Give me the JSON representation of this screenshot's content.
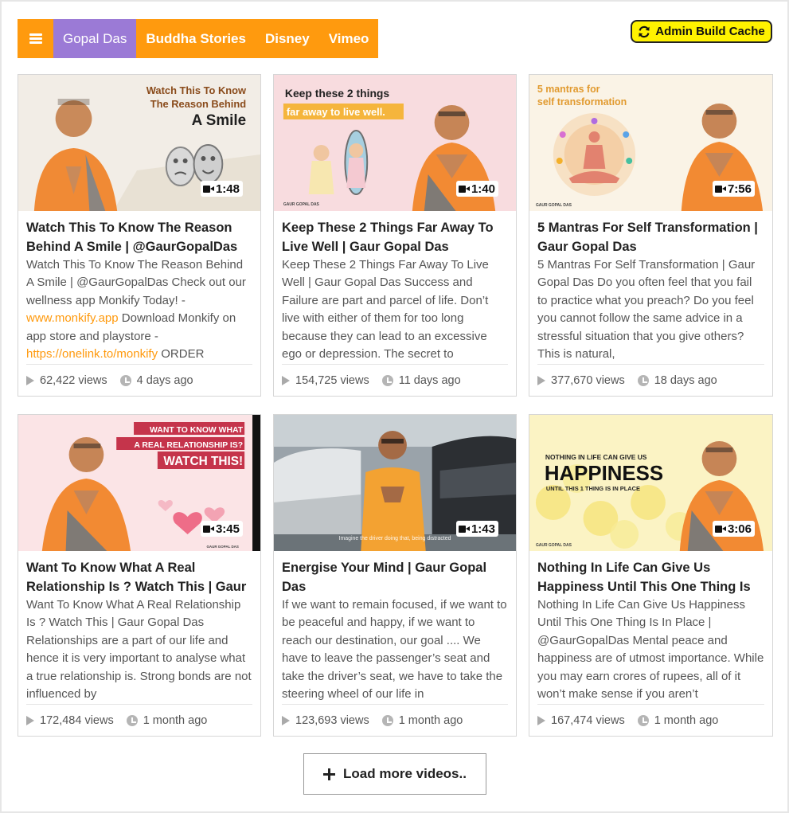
{
  "nav": {
    "menu_icon": "hamburger-icon",
    "tabs": [
      {
        "label": "Gopal Das",
        "active": true
      },
      {
        "label": "Buddha Stories",
        "active": false
      },
      {
        "label": "Disney",
        "active": false
      },
      {
        "label": "Vimeo",
        "active": false
      }
    ]
  },
  "admin": {
    "label": "Admin Build Cache",
    "icon": "refresh-icon"
  },
  "videos": [
    {
      "duration": "1:48",
      "title": "Watch This To Know The Reason Behind A Smile | @GaurGopalDas",
      "desc_text": "Watch This To Know The Reason Behind A Smile | @GaurGopalDas Check out our wellness app Monkify Today! - ",
      "desc_link1": "www.monkify.app",
      "desc_mid": " Download Monkify on app store and playstore - ",
      "desc_link2": "https://onelink.to/monkify",
      "desc_tail": " ORDER",
      "views": "62,422 views",
      "ago": "4 days ago",
      "thumb": {
        "line1": "Watch This To Know",
        "line2": "The Reason Behind",
        "line3": "A Smile"
      }
    },
    {
      "duration": "1:40",
      "title": "Keep These 2 Things Far Away To Live Well | Gaur Gopal Das",
      "desc_text": "Keep These 2 Things Far Away To Live Well | Gaur Gopal Das Success and Failure are part and parcel of life. Don’t live with either of them for too long because they can lead to an excessive ego or depression. The secret to",
      "views": "154,725 views",
      "ago": "11 days ago",
      "thumb": {
        "line1": "Keep these 2 things",
        "line2": "far away to live well.",
        "brand": "GAUR GOPAL DAS"
      }
    },
    {
      "duration": "7:56",
      "title": "5 Mantras For Self Transformation | Gaur Gopal Das",
      "desc_text": "5 Mantras For Self Transformation | Gaur Gopal Das Do you often feel that you fail to practice what you preach? Do you feel you cannot follow the same advice in a stressful situation that you give others? This is natural,",
      "views": "377,670 views",
      "ago": "18 days ago",
      "thumb": {
        "line1": "5 mantras for",
        "line2": "self transformation",
        "brand": "GAUR GOPAL DAS"
      }
    },
    {
      "duration": "3:45",
      "title": "Want To Know What A Real Relationship Is ? Watch This | Gaur Gopal Das",
      "desc_text": "Want To Know What A Real Relationship Is ? Watch This | Gaur Gopal Das Relationships are a part of our life and hence it is very important to analyse what a true relationship is. Strong bonds are not influenced by",
      "views": "172,484 views",
      "ago": "1 month ago",
      "thumb": {
        "line1": "WANT TO KNOW WHAT",
        "line2": "A REAL RELATIONSHIP IS?",
        "line3": "WATCH THIS!",
        "brand": "GAUR GOPAL DAS"
      }
    },
    {
      "duration": "1:43",
      "title": "Energise Your Mind | Gaur Gopal Das",
      "desc_text": "If we want to remain focused, if we want to be peaceful and happy, if we want to reach our destination, our goal .... We have to leave the passenger’s seat and take the driver’s seat, we have to take the steering wheel of our life in",
      "views": "123,693 views",
      "ago": "1 month ago",
      "thumb": {
        "caption": "Imagine the driver doing that, being distracted"
      }
    },
    {
      "duration": "3:06",
      "title": "Nothing In Life Can Give Us Happiness Until This One Thing Is In Place",
      "desc_text": "Nothing In Life Can Give Us Happiness Until This One Thing Is In Place | @GaurGopalDas Mental peace and happiness are of utmost importance. While you may earn crores of rupees, all of it won’t make sense if you aren’t",
      "views": "167,474 views",
      "ago": "1 month ago",
      "thumb": {
        "line1": "NOTHING IN LIFE CAN GIVE US",
        "line2": "HAPPINESS",
        "line3": "UNTIL THIS 1 THING IS IN PLACE",
        "brand": "GAUR GOPAL DAS"
      }
    }
  ],
  "load_more": {
    "label": "Load more videos..",
    "icon": "plus-icon"
  },
  "colors": {
    "accent": "#ff9a0e",
    "active_tab": "#9b7ad6",
    "cache_button": "#fff200"
  }
}
